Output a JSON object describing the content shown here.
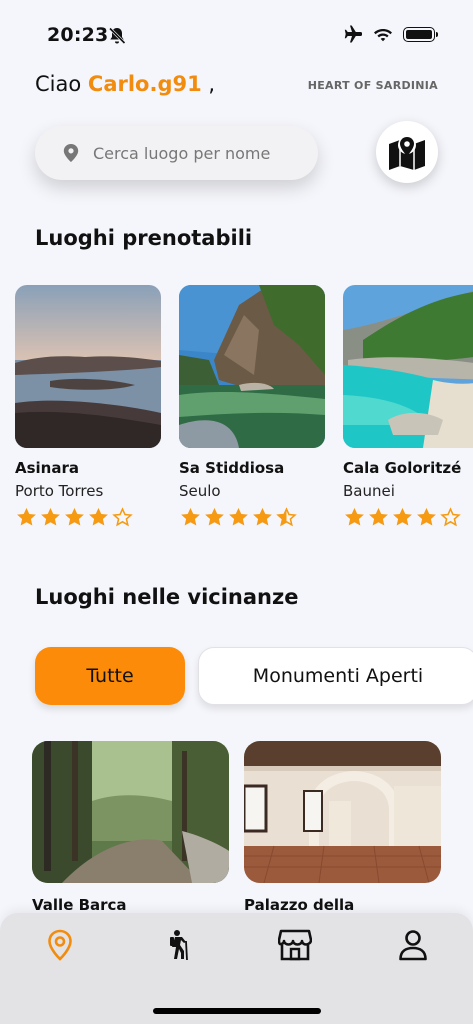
{
  "status_bar": {
    "time": "20:23"
  },
  "header": {
    "greeting_prefix": "Ciao",
    "username": "Carlo.g91",
    "greeting_suffix": " ,",
    "brand": "HEART OF SARDINIA"
  },
  "search": {
    "placeholder": "Cerca luogo per nome"
  },
  "bookable": {
    "title": "Luoghi prenotabili",
    "items": [
      {
        "name": "Asinara",
        "city": "Porto Torres",
        "rating": 4
      },
      {
        "name": "Sa Stiddiosa",
        "city": "Seulo",
        "rating": 4.5
      },
      {
        "name": "Cala Goloritzé",
        "city": "Baunei",
        "rating": 4
      }
    ]
  },
  "nearby": {
    "title": "Luoghi nelle vicinanze",
    "filters": [
      "Tutte",
      "Monumenti Aperti"
    ],
    "active_filter": "Tutte",
    "items": [
      {
        "name": "Valle Barca"
      },
      {
        "name": "Palazzo della"
      }
    ]
  },
  "bottom_nav": {
    "items": [
      "location-pin-icon",
      "hiking-icon",
      "store-icon",
      "user-icon"
    ],
    "active": "location-pin-icon"
  },
  "colors": {
    "accent": "#f28c0f",
    "star": "#f59a12",
    "chip_active": "#fb8b08"
  }
}
